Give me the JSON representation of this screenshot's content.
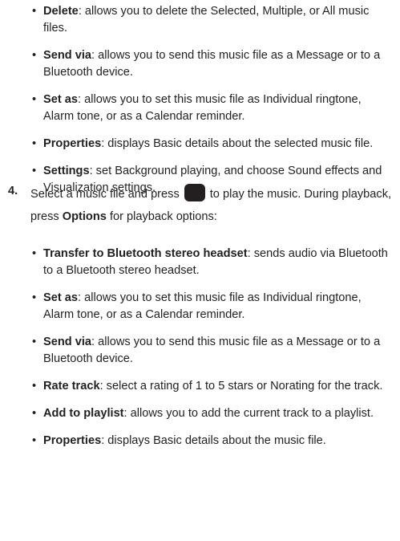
{
  "section_one": [
    {
      "term": "Delete",
      "desc": ": allows you to delete the Selected, Multiple, or All music files."
    },
    {
      "term": "Send via",
      "desc": ": allows you to send this music file as a Message or to a Bluetooth device."
    },
    {
      "term": "Set as",
      "desc": ": allows you to set this music file as Individual ringtone, Alarm tone, or as a Calendar reminder."
    },
    {
      "term": "Properties",
      "desc": ": displays Basic details about the selected music file."
    },
    {
      "term": "Settings",
      "desc": ": set Background playing, and choose Sound effects and Visualization settings."
    }
  ],
  "step": {
    "number": "4.",
    "text_before_icon": "Select a music file and press",
    "key_icon": "select-key-icon",
    "text_after_icon": "to play the music. During playback, press",
    "options_word": "Options",
    "text_end": "for playback options:"
  },
  "section_two": [
    {
      "term": "Transfer to Bluetooth stereo headset",
      "desc": ": sends audio via Bluetooth to a Bluetooth stereo headset."
    },
    {
      "term": "Set as",
      "desc": ": allows you to set this music file as Individual ringtone, Alarm tone, or as a Calendar reminder."
    },
    {
      "term": "Send via",
      "desc": ": allows you to send this music file as a Message or to a Bluetooth device."
    },
    {
      "term": "Rate track",
      "desc": ": select a rating of 1 to 5 stars or Norating for the track."
    },
    {
      "term": "Add to playlist",
      "desc": ": allows you to add the current track to a playlist."
    },
    {
      "term": "Properties",
      "desc": ": displays Basic details about the music file."
    }
  ]
}
